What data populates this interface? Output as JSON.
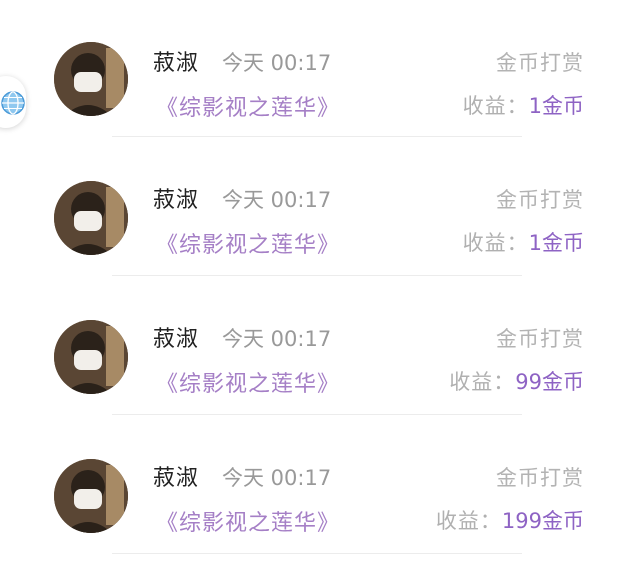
{
  "records": [
    {
      "user": "菽淑",
      "time": "今天 00:17",
      "type": "金币打赏",
      "source": "《综影视之莲华》",
      "income_label": "收益：",
      "income_amount": "1金币"
    },
    {
      "user": "菽淑",
      "time": "今天 00:17",
      "type": "金币打赏",
      "source": "《综影视之莲华》",
      "income_label": "收益：",
      "income_amount": "1金币"
    },
    {
      "user": "菽淑",
      "time": "今天 00:17",
      "type": "金币打赏",
      "source": "《综影视之莲华》",
      "income_label": "收益：",
      "income_amount": "99金币"
    },
    {
      "user": "菽淑",
      "time": "今天 00:17",
      "type": "金币打赏",
      "source": "《综影视之莲华》",
      "income_label": "收益：",
      "income_amount": "199金币"
    }
  ],
  "floating_button_icon": "globe-icon",
  "colors": {
    "accent": "#8e63c4",
    "source_link": "#a57fc6",
    "muted": "#999999"
  }
}
